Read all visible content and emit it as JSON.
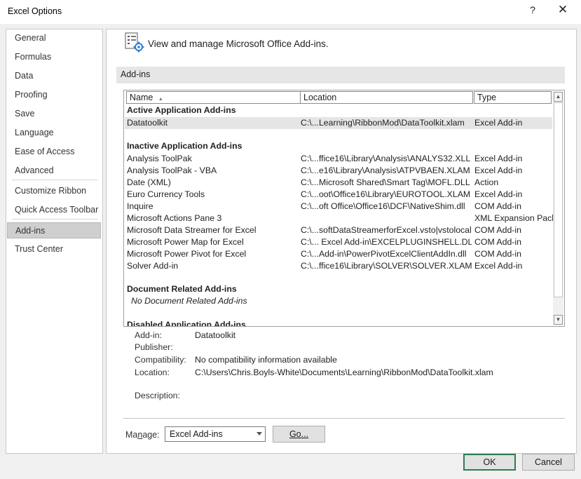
{
  "window": {
    "title": "Excel Options",
    "help_glyph": "?",
    "close_glyph": "✕"
  },
  "nav": {
    "group1": [
      {
        "label": "General",
        "name": "nav-general"
      },
      {
        "label": "Formulas",
        "name": "nav-formulas"
      },
      {
        "label": "Data",
        "name": "nav-data"
      },
      {
        "label": "Proofing",
        "name": "nav-proofing"
      },
      {
        "label": "Save",
        "name": "nav-save"
      },
      {
        "label": "Language",
        "name": "nav-language"
      },
      {
        "label": "Ease of Access",
        "name": "nav-ease-of-access"
      },
      {
        "label": "Advanced",
        "name": "nav-advanced"
      }
    ],
    "group2": [
      {
        "label": "Customize Ribbon",
        "name": "nav-customize-ribbon"
      },
      {
        "label": "Quick Access Toolbar",
        "name": "nav-quick-access-toolbar"
      }
    ],
    "group3": [
      {
        "label": "Add-ins",
        "name": "nav-add-ins",
        "selected": true
      },
      {
        "label": "Trust Center",
        "name": "nav-trust-center"
      }
    ]
  },
  "header": {
    "text": "View and manage Microsoft Office Add-ins.",
    "icon": "add-ins-gear-icon"
  },
  "section": {
    "title": "Add-ins"
  },
  "list": {
    "columns": {
      "name": "Name",
      "location": "Location",
      "type": "Type"
    },
    "sort_glyph": "▲",
    "groups": [
      {
        "title": "Active Application Add-ins",
        "items": [
          {
            "name": "Datatoolkit",
            "location": "C:\\...Learning\\RibbonMod\\DataToolkit.xlam",
            "type": "Excel Add-in",
            "selected": true
          }
        ]
      },
      {
        "title": "Inactive Application Add-ins",
        "items": [
          {
            "name": "Analysis ToolPak",
            "location": "C:\\...ffice16\\Library\\Analysis\\ANALYS32.XLL",
            "type": "Excel Add-in"
          },
          {
            "name": "Analysis ToolPak - VBA",
            "location": "C:\\...e16\\Library\\Analysis\\ATPVBAEN.XLAM",
            "type": "Excel Add-in"
          },
          {
            "name": "Date (XML)",
            "location": "C:\\...Microsoft Shared\\Smart Tag\\MOFL.DLL",
            "type": "Action"
          },
          {
            "name": "Euro Currency Tools",
            "location": "C:\\...oot\\Office16\\Library\\EUROTOOL.XLAM",
            "type": "Excel Add-in"
          },
          {
            "name": "Inquire",
            "location": "C:\\...oft Office\\Office16\\DCF\\NativeShim.dll",
            "type": "COM Add-in"
          },
          {
            "name": "Microsoft Actions Pane 3",
            "location": "",
            "type": "XML Expansion Pack"
          },
          {
            "name": "Microsoft Data Streamer for Excel",
            "location": "C:\\...softDataStreamerforExcel.vsto|vstolocal",
            "type": "COM Add-in"
          },
          {
            "name": "Microsoft Power Map for Excel",
            "location": "C:\\... Excel Add-in\\EXCELPLUGINSHELL.DLL",
            "type": "COM Add-in"
          },
          {
            "name": "Microsoft Power Pivot for Excel",
            "location": "C:\\...Add-in\\PowerPivotExcelClientAddIn.dll",
            "type": "COM Add-in"
          },
          {
            "name": "Solver Add-in",
            "location": "C:\\...ffice16\\Library\\SOLVER\\SOLVER.XLAM",
            "type": "Excel Add-in"
          }
        ]
      },
      {
        "title": "Document Related Add-ins",
        "empty_text": "No Document Related Add-ins",
        "items": []
      },
      {
        "title": "Disabled Application Add-ins",
        "items": []
      }
    ],
    "scroll_up": "▲",
    "scroll_down": "▼"
  },
  "details": {
    "addin_label": "Add-in:",
    "addin_value": "Datatoolkit",
    "publisher_label": "Publisher:",
    "publisher_value": "",
    "compat_label": "Compatibility:",
    "compat_value": "No compatibility information available",
    "location_label": "Location:",
    "location_value": "C:\\Users\\Chris.Boyls-White\\Documents\\Learning\\RibbonMod\\DataToolkit.xlam",
    "description_label": "Description:"
  },
  "manage": {
    "label": "Manage:",
    "value": "Excel Add-ins",
    "go_label": "Go..."
  },
  "footer": {
    "ok_label": "OK",
    "cancel_label": "Cancel"
  },
  "colors": {
    "ok_border": "#2e7d52",
    "selected_nav": "#cfcfcf",
    "selected_row": "#e5e5e5"
  }
}
